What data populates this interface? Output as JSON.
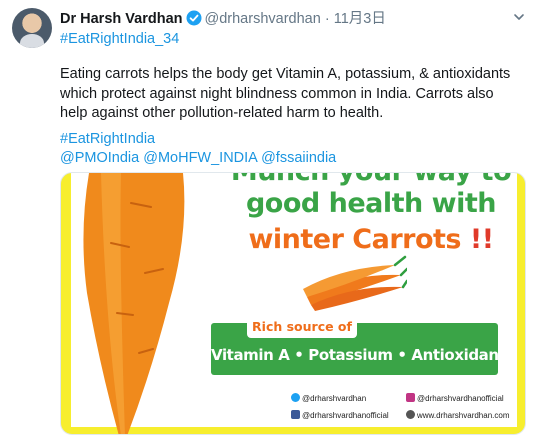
{
  "tweet": {
    "author_name": "Dr Harsh Vardhan",
    "handle": "@drharshvardhan",
    "separator": "·",
    "time": "11月3日",
    "hashtag_top": "#EatRightIndia_34",
    "body_lines": [
      "Eating carrots helps the body get Vitamin A, potassium, & antioxidants",
      "which protect against night blindness common in India. Carrots also",
      "help against other pollution-related harm to health."
    ],
    "hashtag_bottom": "#EatRightIndia",
    "mentions": [
      "@PMOIndia",
      "@MoHFW_INDIA",
      "@fssaiindia"
    ]
  },
  "media": {
    "headline_line0": "Munch your way to",
    "headline_line1": "good health with",
    "headline_orange": "winter Carrots",
    "headline_exclaim": " !!",
    "rich_label": "Rich source of",
    "nutrients": "Vitamin A • Potassium • Antioxidants",
    "socials": {
      "twitter": "@drharshvardhan",
      "instagram": "@drharshvardhanofficial",
      "facebook": "@drharshvardhanofficial",
      "website": "www.drharshvardhan.com"
    }
  },
  "colors": {
    "link": "#1b95e0",
    "green": "#3aa447",
    "orange": "#ef6d1a",
    "red": "#e03a2a",
    "yellow": "#f7ee2e"
  },
  "icons": [
    "verified-badge-icon",
    "chevron-down-icon",
    "twitter-icon",
    "instagram-icon",
    "facebook-icon",
    "globe-icon"
  ]
}
